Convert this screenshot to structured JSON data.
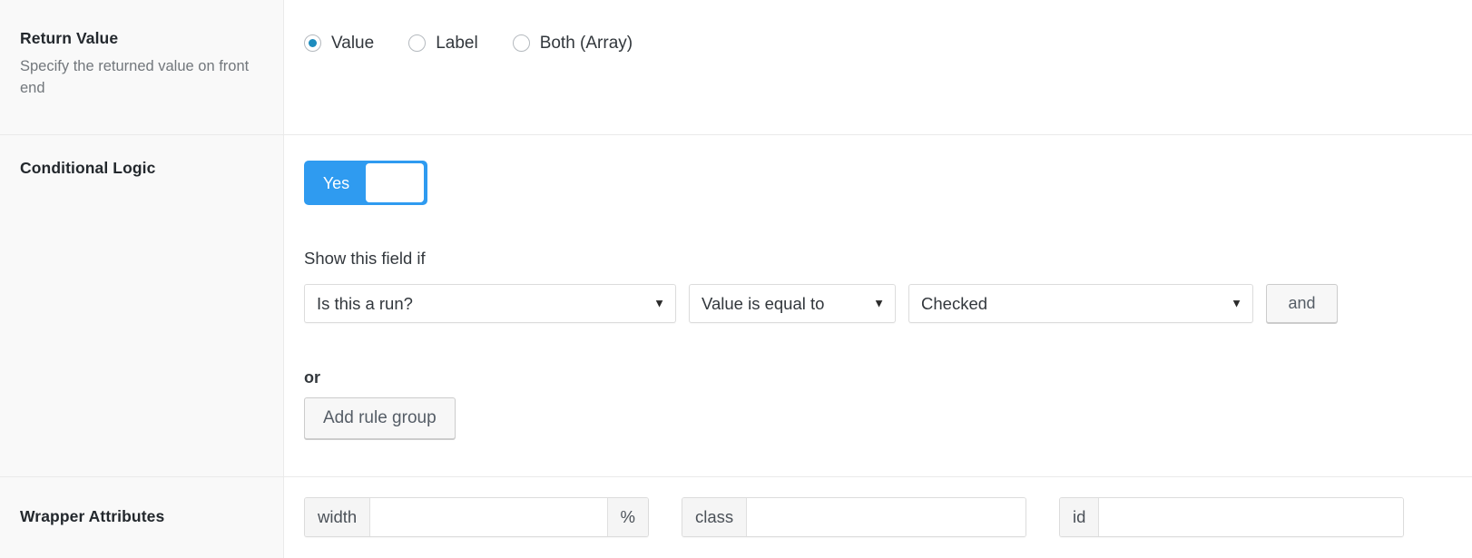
{
  "theme": {
    "accent_blue": "#2f9bf0",
    "radio_blue": "#1e8cbe",
    "label_bg": "#f9f9f9",
    "border": "#eaeaea",
    "text": "#32373c",
    "muted_text": "#72777c"
  },
  "rows": {
    "return_value": {
      "label": "Return Value",
      "description": "Specify the returned value on front end",
      "options": [
        {
          "label": "Value",
          "checked": true
        },
        {
          "label": "Label",
          "checked": false
        },
        {
          "label": "Both (Array)",
          "checked": false
        }
      ]
    },
    "conditional_logic": {
      "label": "Conditional Logic",
      "toggle": {
        "state_label": "Yes",
        "enabled": true
      },
      "caption": "Show this field if",
      "rule": {
        "field": "Is this a run?",
        "operator": "Value is equal to",
        "value": "Checked",
        "and_button": "and",
        "arrow_glyph": "▼"
      },
      "or_label": "or",
      "add_rule_group_button": "Add rule group"
    },
    "wrapper_attributes": {
      "label": "Wrapper Attributes",
      "fields": [
        {
          "name": "width",
          "prepend": "width",
          "append": "%",
          "value": "",
          "placeholder": ""
        },
        {
          "name": "class",
          "prepend": "class",
          "append": "",
          "value": "",
          "placeholder": ""
        },
        {
          "name": "id",
          "prepend": "id",
          "append": "",
          "value": "",
          "placeholder": ""
        }
      ]
    }
  }
}
